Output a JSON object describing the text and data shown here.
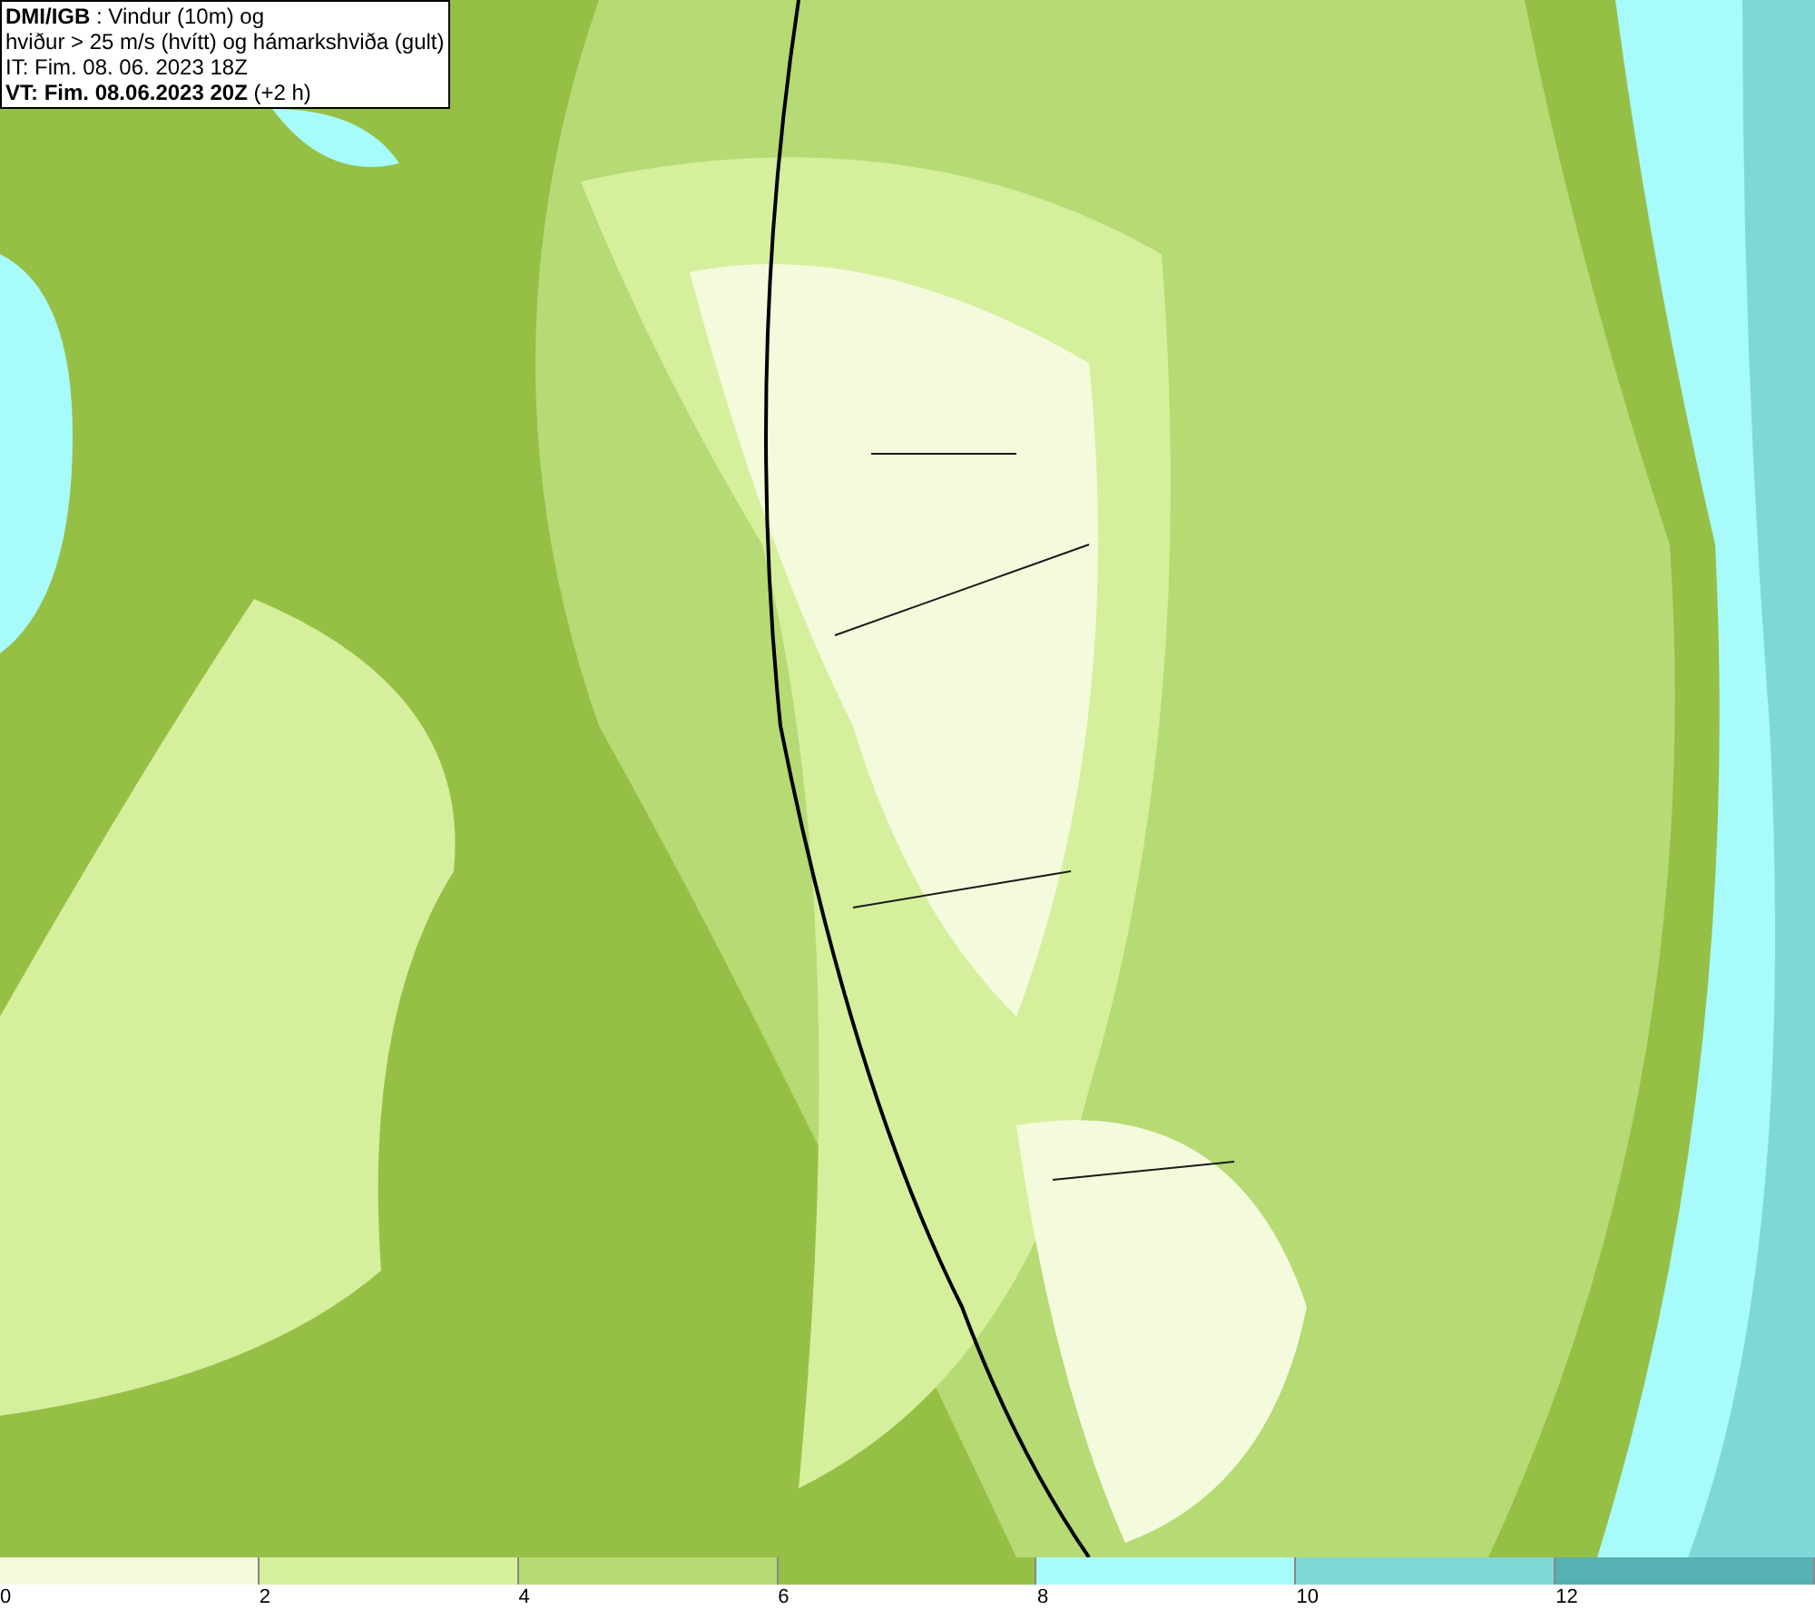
{
  "header": {
    "lines": [
      "**DMI/IGB** : Vindur (10m) og",
      "hviður > 25 m/s (hvítt) og hámarkshviða (gult)",
      "IT: Fim. 08. 06. 2023 18Z",
      "**VT: Fim. 08.06.2023 20Z** (+2 h)"
    ]
  },
  "legend": [
    {
      "label": "0",
      "color": "#f4fbdc"
    },
    {
      "label": "2",
      "color": "#d6ef9c"
    },
    {
      "label": "4",
      "color": "#b6da74"
    },
    {
      "label": "6",
      "color": "#96bf46"
    },
    {
      "label": "8",
      "color": "#a8fbfb"
    },
    {
      "label": "10",
      "color": "#7fd8d8"
    },
    {
      "label": "12",
      "color": "#55b1b3"
    }
  ]
}
